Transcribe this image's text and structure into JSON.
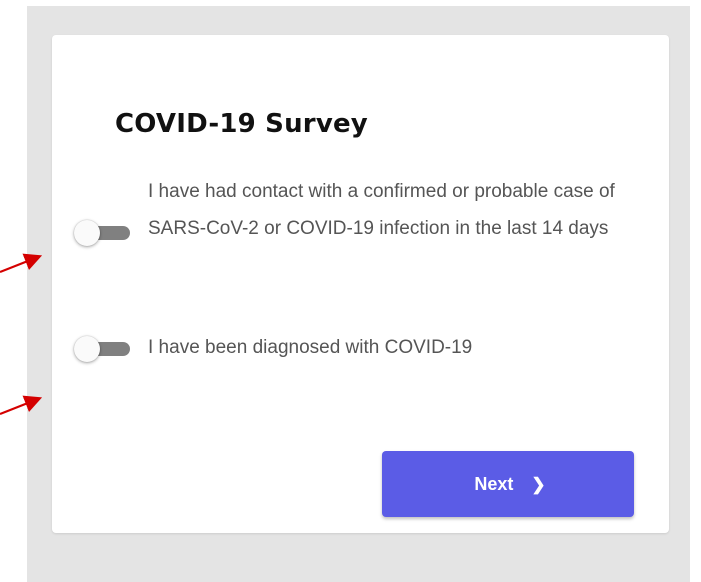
{
  "survey": {
    "title": "COVID-19 Survey",
    "options": [
      {
        "label": "I have had contact with a confirmed or probable case of SARS-CoV-2 or COVID-19 infection in the last 14 days",
        "checked": false
      },
      {
        "label": "I have been diagnosed with COVID-19",
        "checked": false
      }
    ],
    "next_label": "Next",
    "next_icon": "chevron-right-icon"
  },
  "colors": {
    "backdrop": "#e4e4e4",
    "card": "#ffffff",
    "button": "#5b5ce6",
    "toggle_track_off": "#808080",
    "annotation_arrow": "#d40000"
  },
  "annotations": {
    "arrow_icon": "red-pointer-arrow-icon",
    "count": 2
  }
}
